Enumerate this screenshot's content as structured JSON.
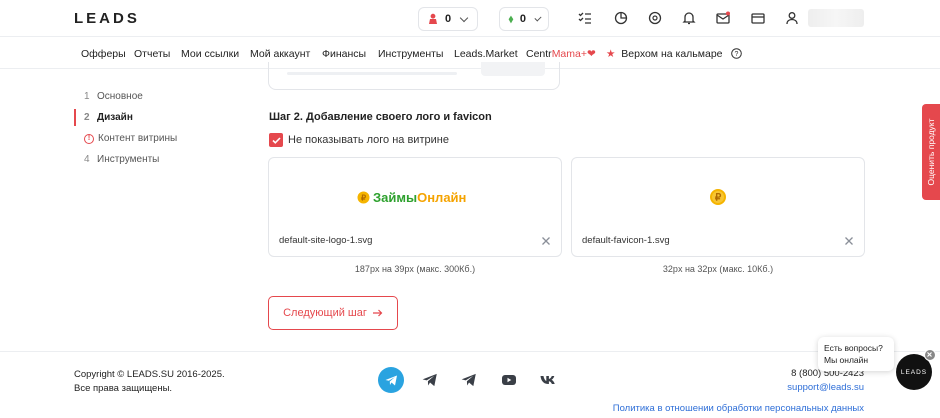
{
  "header": {
    "logo": "LEADS",
    "counter1": "0",
    "counter2": "0"
  },
  "nav": {
    "items": [
      "Офферы",
      "Отчеты",
      "Мои ссылки",
      "Мой аккаунт",
      "Финансы",
      "Инструменты",
      "Leads.Market"
    ],
    "centr_prefix": "Centr",
    "centr_suffix": "Mama+",
    "promo": "Верхом на кальмаре"
  },
  "steps": [
    {
      "num": "1",
      "label": "Основное"
    },
    {
      "num": "2",
      "label": "Дизайн"
    },
    {
      "num": "",
      "label": "Контент витрины"
    },
    {
      "num": "4",
      "label": "Инструменты"
    }
  ],
  "section": {
    "title": "Шаг 2. Добавление своего лого и favicon",
    "checkbox_label": "Не показывать лого на витрине",
    "checkbox_checked": true
  },
  "logo_card": {
    "preview_text_green": "Займы",
    "preview_text_orange": "Онлайн",
    "filename": "default-site-logo-1.svg",
    "hint": "187px на 39px (макс. 300Кб.)"
  },
  "favicon_card": {
    "filename": "default-favicon-1.svg",
    "hint": "32px на 32px (макс. 10Кб.)"
  },
  "next_button": "Следующий шаг",
  "footer": {
    "copyright": "Copyright © LEADS.SU 2016-2025.",
    "rights": "Все права защищены.",
    "phone": "8 (800) 500-2423",
    "email": "support@leads.su",
    "policy": "Политика в отношении обработки персональных данных",
    "social": [
      "telegram-icon",
      "telegram-icon",
      "telegram-icon",
      "youtube-icon",
      "vk-icon"
    ]
  },
  "rate_tab": "Оценить продукт",
  "chat": {
    "line1": "Есть вопросы?",
    "line2": "Мы онлайн",
    "button": "LEADS"
  },
  "colors": {
    "accent": "#e5484d",
    "link": "#2f6fd8"
  }
}
